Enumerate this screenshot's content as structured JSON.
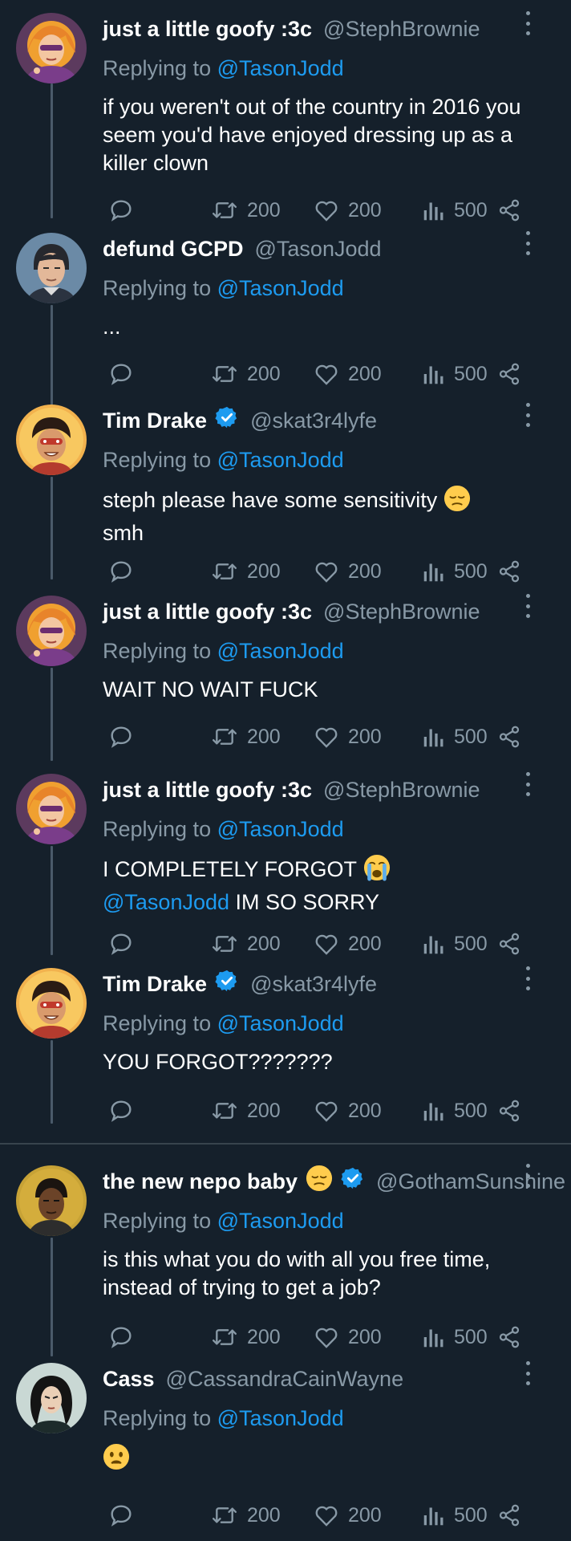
{
  "tweets": [
    {
      "name": "just a little goofy :3c",
      "handle": "@StephBrownie",
      "replying_prefix": "Replying to",
      "replying_handle": "@TasonJodd",
      "text": "if you weren't out of the country in 2016 you seem you'd have enjoyed dressing up as a killer clown",
      "replies": "",
      "retweets": "200",
      "likes": "200",
      "views": "500",
      "avatar": "steph-avatar"
    },
    {
      "name": "defund GCPD",
      "handle": "@TasonJodd",
      "replying_prefix": "Replying to",
      "replying_handle": "@TasonJodd",
      "text": "...",
      "retweets": "200",
      "likes": "200",
      "views": "500",
      "avatar": "jason-avatar"
    },
    {
      "name": "Tim Drake",
      "handle": "@skat3r4lyfe",
      "verified": true,
      "replying_prefix": "Replying to",
      "replying_handle": "@TasonJodd",
      "text": "steph please have some sensitivity",
      "text_line2": "smh",
      "text_emoji": "pensive-face-emoji",
      "retweets": "200",
      "likes": "200",
      "views": "500",
      "avatar": "tim-avatar"
    },
    {
      "name": "just a little goofy :3c",
      "handle": "@StephBrownie",
      "replying_prefix": "Replying to",
      "replying_handle": "@TasonJodd",
      "text": "WAIT NO WAIT FUCK",
      "retweets": "200",
      "likes": "200",
      "views": "500",
      "avatar": "steph-avatar"
    },
    {
      "name": "just a little goofy :3c",
      "handle": "@StephBrownie",
      "replying_prefix": "Replying to",
      "replying_handle": "@TasonJodd",
      "text": "I COMPLETELY FORGOT",
      "text_emoji": "loudly-crying-face-emoji",
      "text_mention": "@TasonJodd",
      "text_tail": "IM SO SORRY",
      "retweets": "200",
      "likes": "200",
      "views": "500",
      "avatar": "steph-avatar"
    },
    {
      "name": "Tim Drake",
      "handle": "@skat3r4lyfe",
      "verified": true,
      "replying_prefix": "Replying to",
      "replying_handle": "@TasonJodd",
      "text": "YOU FORGOT???????",
      "retweets": "200",
      "likes": "200",
      "views": "500",
      "avatar": "tim-avatar"
    },
    {
      "name": "the new nepo baby",
      "name_emoji": "pensive-face-emoji",
      "handle": "@GothamSunshine",
      "verified": true,
      "replying_prefix": "Replying to",
      "replying_handle": "@TasonJodd",
      "text": "is this what you do with all you free time, instead of trying to get a job?",
      "retweets": "200",
      "likes": "200",
      "views": "500",
      "avatar": "duke-avatar"
    },
    {
      "name": "Cass",
      "handle": "@CassandraCainWayne",
      "replying_prefix": "Replying to",
      "replying_handle": "@TasonJodd",
      "text_emoji": "frowning-face-emoji",
      "retweets": "200",
      "likes": "200",
      "views": "500",
      "avatar": "cass-avatar"
    }
  ],
  "colors": {
    "background": "#15202b",
    "secondary_text": "#8899a6",
    "mention": "#1d9bf0",
    "verified": "#1d9bf0",
    "thread_line": "#4a5a6a"
  }
}
